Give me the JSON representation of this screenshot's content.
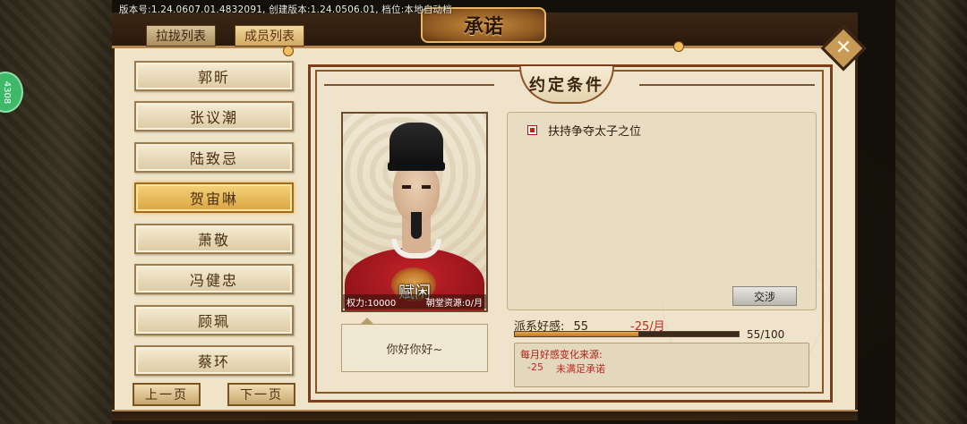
{
  "version_line": "版本号:1.24.0607.01.4832091,  创建版本:1.24.0506.01,  档位:本地自动档",
  "side_badge": "4308",
  "title": "承诺",
  "tabs": [
    {
      "label": "拉拢列表",
      "active": false
    },
    {
      "label": "成员列表",
      "active": true
    }
  ],
  "members": [
    {
      "name": "郭昕",
      "selected": false
    },
    {
      "name": "张议潮",
      "selected": false
    },
    {
      "name": "陆致忌",
      "selected": false
    },
    {
      "name": "贺宙啉",
      "selected": true
    },
    {
      "name": "萧敬",
      "selected": false
    },
    {
      "name": "冯健忠",
      "selected": false
    },
    {
      "name": "顾珮",
      "selected": false
    },
    {
      "name": "蔡环",
      "selected": false
    }
  ],
  "pager": {
    "prev": "上一页",
    "next": "下一页"
  },
  "panel_title": "约定条件",
  "portrait": {
    "name": "赋闲",
    "power": "权力:10000",
    "resource": "朝堂资源:0/月"
  },
  "speech": "你好你好~",
  "conditions": [
    {
      "text": "扶持争夺太子之位",
      "checked": true
    }
  ],
  "negotiate_label": "交涉",
  "favor": {
    "label": "派系好感:",
    "value": "55",
    "delta": "-25/月",
    "current": 55,
    "max": 100,
    "progress_text": "55/100"
  },
  "monthly": {
    "title": "每月好感变化来源:",
    "entries": [
      {
        "amount": "-25",
        "reason": "未满足承诺"
      }
    ]
  },
  "colors": {
    "accent": "#d9a443",
    "negative": "#c0281c",
    "frame": "#7a3e1a"
  }
}
